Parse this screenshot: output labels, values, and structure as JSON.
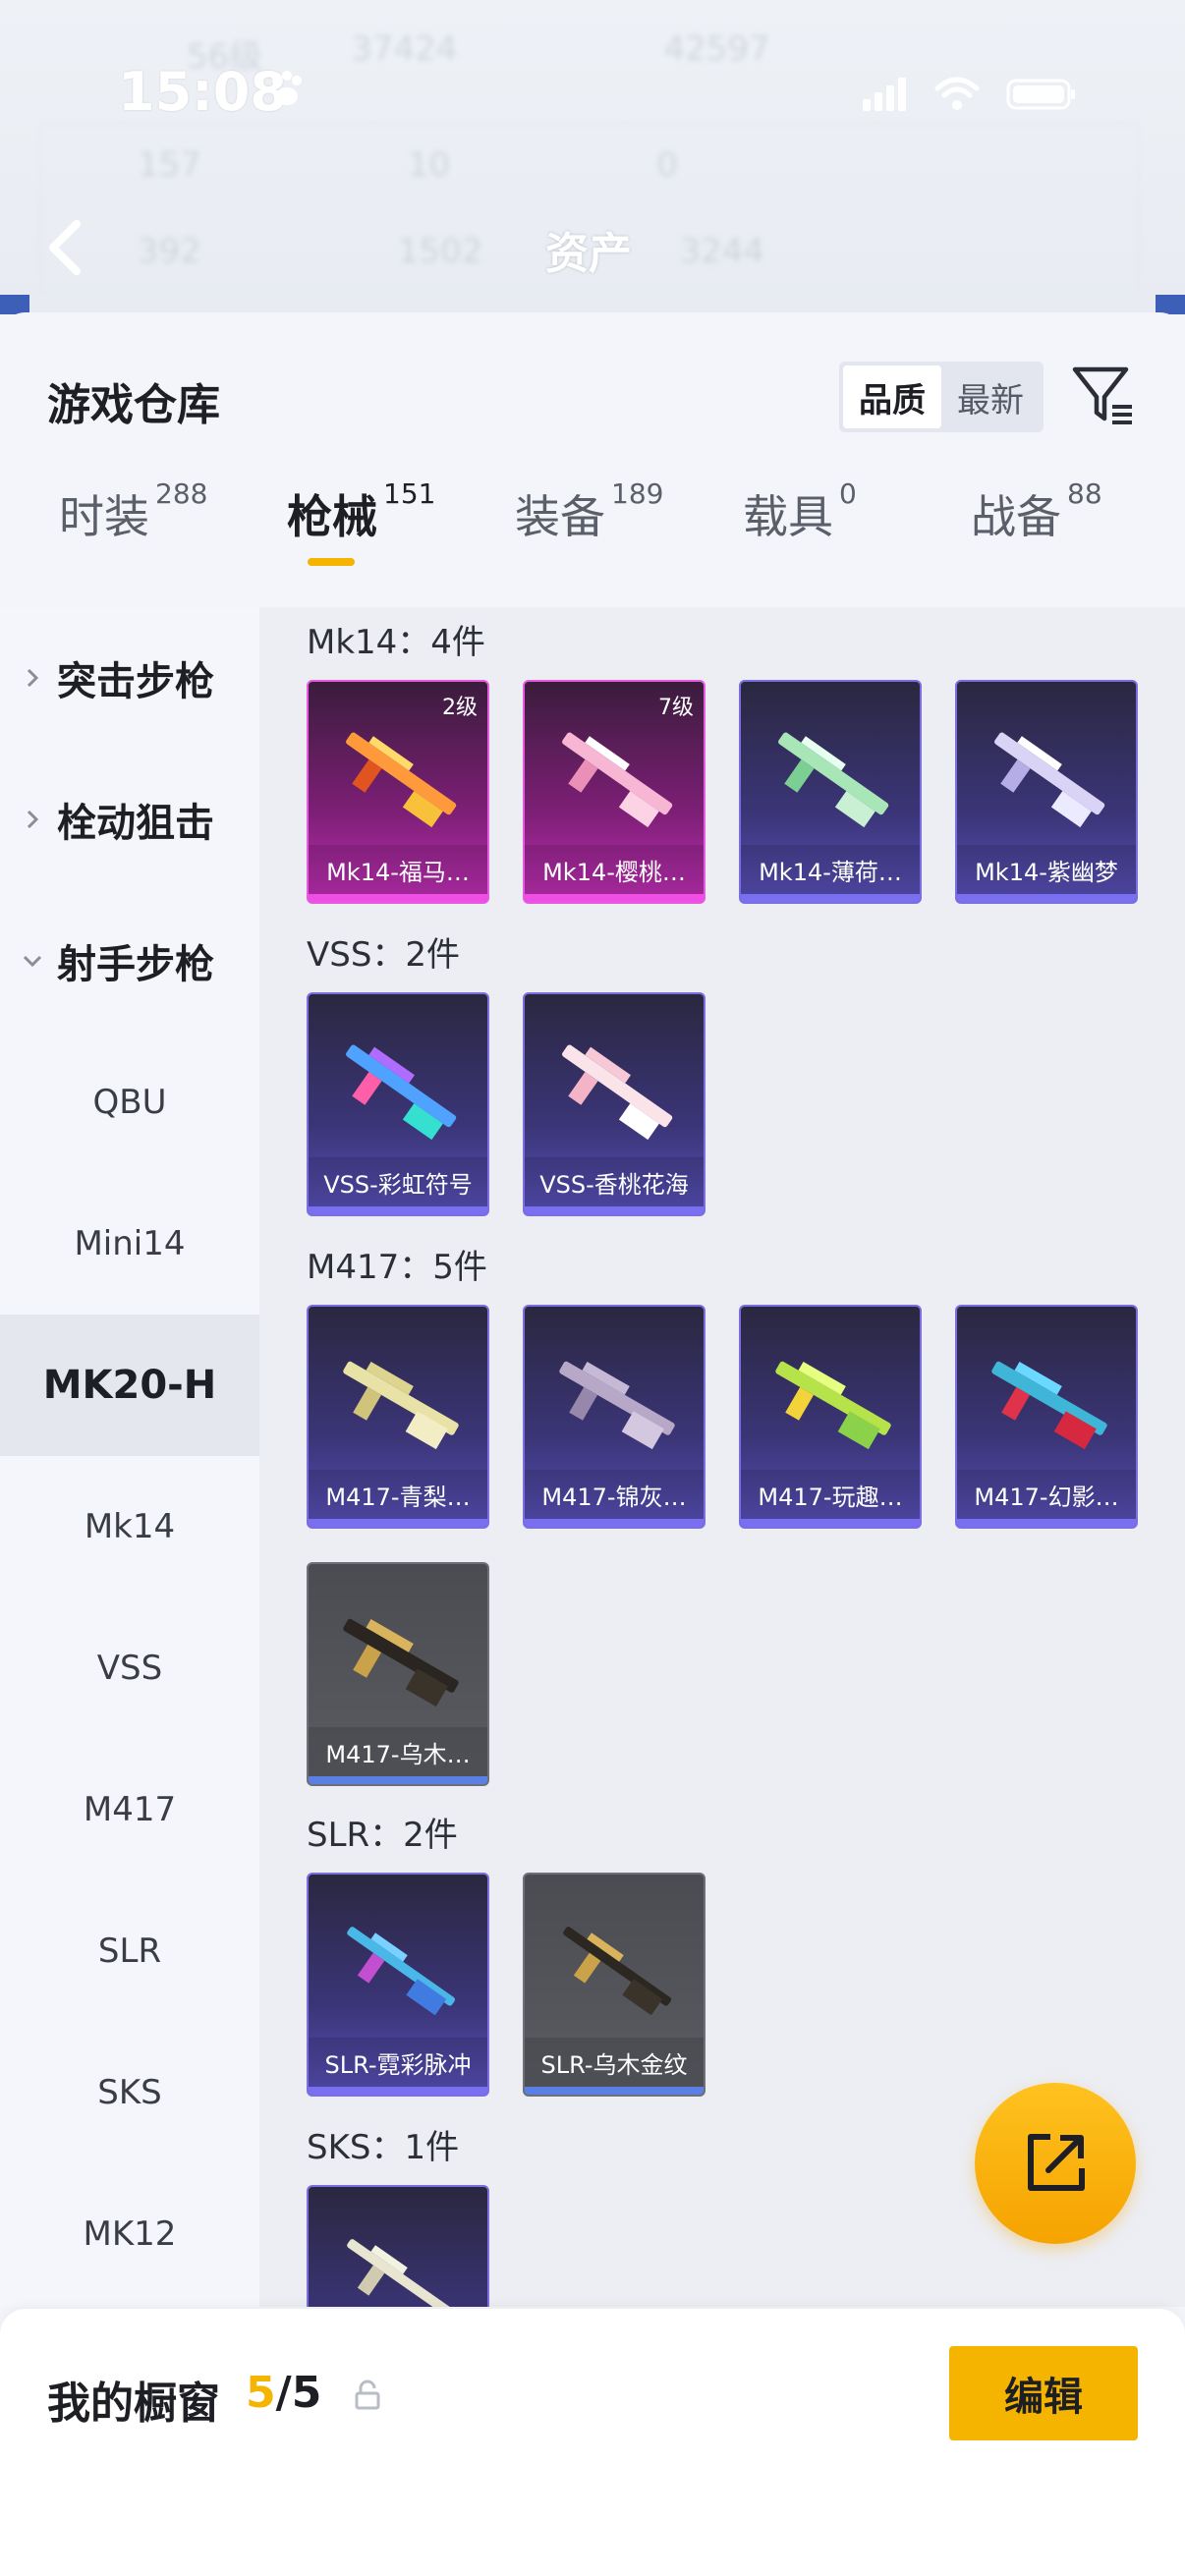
{
  "status": {
    "time": "15:08"
  },
  "header": {
    "title": "资产"
  },
  "background_text": {
    "row1": [
      "56级",
      "37424",
      "42597"
    ],
    "row2": [
      "157",
      "10",
      "0"
    ],
    "row3": [
      "392",
      "1502",
      "3244"
    ]
  },
  "sheet": {
    "title": "游戏仓库",
    "sort": {
      "options": [
        "品质",
        "最新"
      ],
      "selected": "品质"
    }
  },
  "tabs": [
    {
      "label": "时装",
      "count": "288"
    },
    {
      "label": "枪械",
      "count": "151"
    },
    {
      "label": "装备",
      "count": "189"
    },
    {
      "label": "载具",
      "count": "0"
    },
    {
      "label": "战备",
      "count": "88"
    }
  ],
  "active_tab": "枪械",
  "sidebar": {
    "categories": [
      "突击步枪",
      "栓动狙击",
      "射手步枪"
    ],
    "items": [
      "QBU",
      "Mini14",
      "MK20-H",
      "Mk14",
      "VSS",
      "M417",
      "SLR",
      "SKS",
      "MK12"
    ],
    "selected": "MK20-H"
  },
  "groups": [
    {
      "title": "Mk14：4件",
      "items": [
        {
          "name": "Mk14-福马…",
          "level": "2级",
          "rarity": "pink"
        },
        {
          "name": "Mk14-樱桃…",
          "level": "7级",
          "rarity": "pink"
        },
        {
          "name": "Mk14-薄荷…",
          "rarity": "purple"
        },
        {
          "name": "Mk14-紫幽梦",
          "rarity": "purple"
        }
      ]
    },
    {
      "title": "VSS：2件",
      "items": [
        {
          "name": "VSS-彩虹符号",
          "rarity": "purple"
        },
        {
          "name": "VSS-香桃花海",
          "rarity": "purple"
        }
      ]
    },
    {
      "title": "M417：5件",
      "items": [
        {
          "name": "M417-青梨…",
          "rarity": "purple"
        },
        {
          "name": "M417-锦灰…",
          "rarity": "purple"
        },
        {
          "name": "M417-玩趣…",
          "rarity": "purple"
        },
        {
          "name": "M417-幻影…",
          "rarity": "purple"
        },
        {
          "name": "M417-乌木…",
          "rarity": "gray"
        }
      ]
    },
    {
      "title": "SLR：2件",
      "items": [
        {
          "name": "SLR-霓彩脉冲",
          "rarity": "purple"
        },
        {
          "name": "SLR-乌木金纹",
          "rarity": "gray"
        }
      ]
    },
    {
      "title": "SKS：1件",
      "items": [
        {
          "name": "",
          "rarity": "purple"
        }
      ]
    }
  ],
  "bottom": {
    "label": "我的橱窗",
    "count_current": "5",
    "count_sep_total": "/5",
    "edit_label": "编辑"
  },
  "colors": {
    "accent": "#f5b400",
    "pink_rarity": "#e65ae0",
    "purple_rarity": "#7b6fe0",
    "gray_rarity": "#6d7077"
  },
  "icons": [
    "paw-icon",
    "back-arrow-icon",
    "filter-icon",
    "chevron-right-icon",
    "chevron-down-icon",
    "share-export-icon",
    "lock-icon",
    "gun-icon"
  ]
}
